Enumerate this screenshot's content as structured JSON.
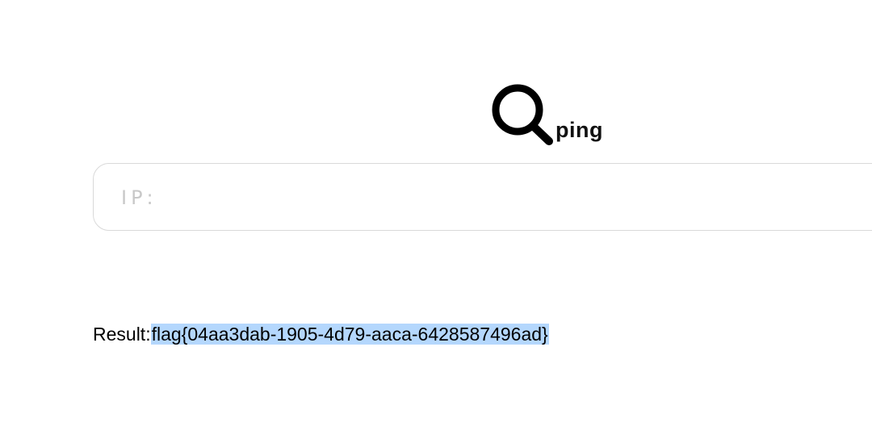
{
  "logo": {
    "icon": "search-icon",
    "text": "ping"
  },
  "ip_input": {
    "placeholder": "IP:",
    "value": ""
  },
  "result": {
    "label": "Result:",
    "value": "flag{04aa3dab-1905-4d79-aaca-6428587496ad}",
    "highlight_color": "#b4d7fd"
  }
}
